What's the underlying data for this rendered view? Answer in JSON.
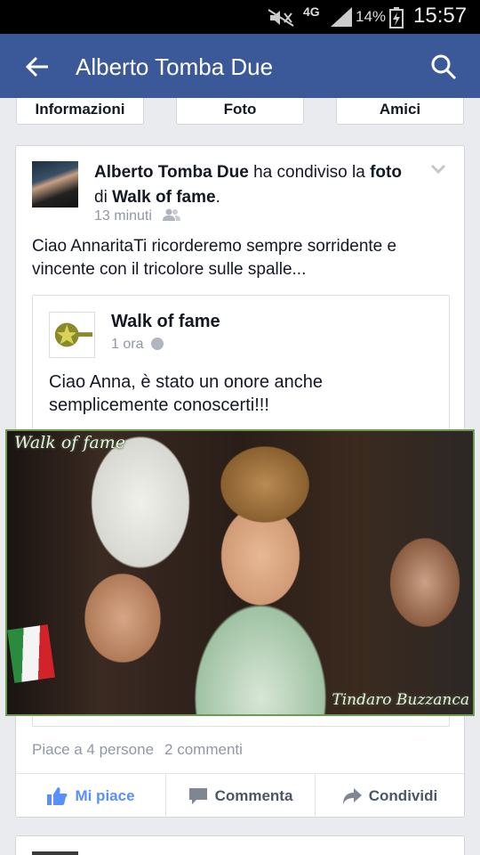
{
  "status_bar": {
    "network": "4G",
    "battery": "14%",
    "time": "15:57"
  },
  "app_bar": {
    "title": "Alberto Tomba Due"
  },
  "tabs": [
    "Informazioni",
    "Foto",
    "Amici"
  ],
  "post": {
    "author": "Alberto Tomba Due",
    "action_text": " ha condiviso la ",
    "object": "foto",
    "preposition": " di ",
    "source": "Walk of fame",
    "period": ".",
    "time": "13 minuti",
    "text": "Ciao AnnaritaTi ricorderemo sempre sorridente e vincente con il tricolore sulle spalle...",
    "shared": {
      "page_name": "Walk of fame",
      "time": "1 ora",
      "text": "Ciao Anna, è stato un onore anche semplicemente conoscerti!!!",
      "photo_watermark_top": "Walk of fame",
      "photo_watermark_bottom": "Tindaro Buzzanca"
    },
    "likes": "Piace a 4 persone",
    "comments": "2 commenti",
    "actions": {
      "like": "Mi piace",
      "comment": "Commenta",
      "share": "Condividi"
    }
  },
  "colors": {
    "brand": "#3b5998",
    "like": "#5890ff",
    "muted": "#9197a3"
  },
  "icons": [
    "mute-icon",
    "signal-icon",
    "battery-icon",
    "back-arrow-icon",
    "search-icon",
    "chevron-down-icon",
    "friends-icon",
    "globe-icon",
    "thumbs-up-icon",
    "comment-icon",
    "share-icon"
  ]
}
